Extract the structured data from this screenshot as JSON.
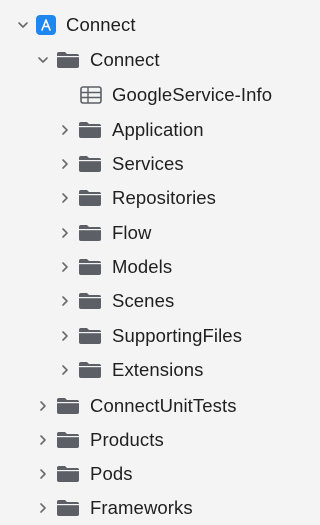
{
  "navigator": {
    "project": {
      "label": "Connect",
      "expanded": true,
      "icon": "xcode-app-icon"
    },
    "group": {
      "label": "Connect",
      "expanded": true,
      "icon": "folder-icon"
    },
    "plist_file": {
      "label": "GoogleService-Info",
      "icon": "plist-file-icon"
    },
    "subfolders": [
      {
        "label": "Application"
      },
      {
        "label": "Services"
      },
      {
        "label": "Repositories"
      },
      {
        "label": "Flow"
      },
      {
        "label": "Models"
      },
      {
        "label": "Scenes"
      },
      {
        "label": "SupportingFiles"
      },
      {
        "label": "Extensions"
      }
    ],
    "top_level": [
      {
        "label": "ConnectUnitTests"
      },
      {
        "label": "Products"
      },
      {
        "label": "Pods"
      },
      {
        "label": "Frameworks"
      }
    ]
  },
  "colors": {
    "background": "#f4f4f4",
    "app_icon": "#1f87f0",
    "folder": "#5c5f66",
    "chevron": "#6b6b6b"
  }
}
